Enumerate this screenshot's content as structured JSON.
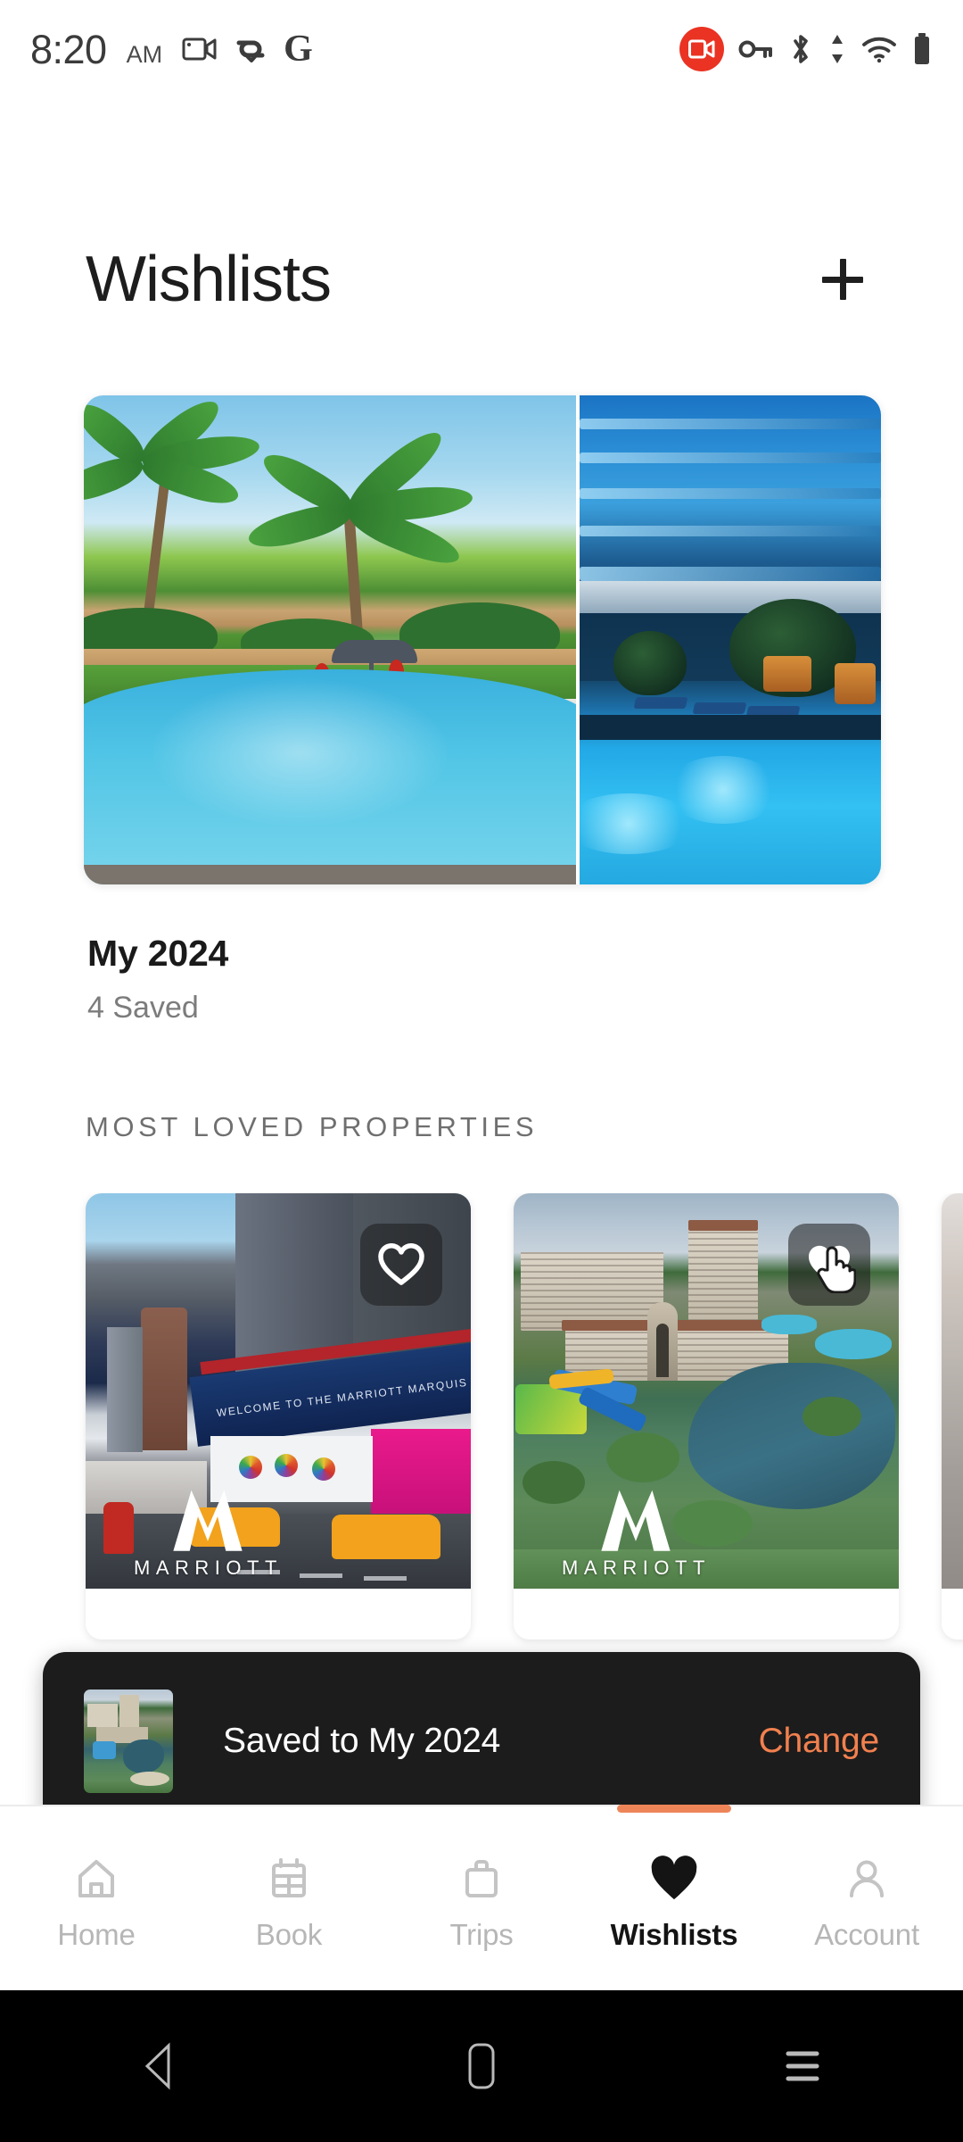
{
  "status_bar": {
    "time": "8:20",
    "meridiem": "AM",
    "left_icons": [
      "video-camera-icon",
      "link-connection-icon",
      "google-g-icon"
    ],
    "right_icons": [
      "screen-recording-badge-icon",
      "vpn-key-icon",
      "bluetooth-icon",
      "data-transfer-icon",
      "wifi-icon",
      "battery-icon"
    ],
    "recording_badge_color": "#EA3323"
  },
  "header": {
    "title": "Wishlists",
    "add_icon": "plus-icon"
  },
  "wishlist": {
    "name": "My 2024",
    "saved_count": "4 Saved",
    "images": [
      {
        "alt": "tropical-resort-pool-with-palm-trees"
      },
      {
        "alt": "night-lit-hotel-pool"
      }
    ]
  },
  "section": {
    "heading": "MOST LOVED PROPERTIES"
  },
  "properties": [
    {
      "image_alt": "marriott-marquis-times-square",
      "brand": "MARRIOTT",
      "favorite_icon": "heart-outline-icon",
      "favorited": false
    },
    {
      "image_alt": "orlando-world-center-marriott-resort",
      "brand": "MARRIOTT",
      "favorite_icon": "heart-filled-icon",
      "favorited": true,
      "cursor_overlay": "pointer-hand-cursor"
    },
    {
      "image_alt": "partial-property-card-peek",
      "brand": "",
      "favorite_icon": "",
      "favorited": false
    }
  ],
  "toast": {
    "thumbnail_alt": "orlando-world-center-marriott-resort",
    "message": "Saved to My 2024",
    "action_label": "Change",
    "action_color": "#F2804F",
    "background": "#1c1c1c"
  },
  "bottom_nav": {
    "active_index": 3,
    "indicator_color": "#EE8559",
    "items": [
      {
        "label": "Home",
        "icon": "home-icon"
      },
      {
        "label": "Book",
        "icon": "calendar-icon"
      },
      {
        "label": "Trips",
        "icon": "suitcase-icon"
      },
      {
        "label": "Wishlists",
        "icon": "heart-filled-icon"
      },
      {
        "label": "Account",
        "icon": "person-icon"
      }
    ]
  },
  "system_nav": {
    "items": [
      {
        "icon": "back-triangle-icon"
      },
      {
        "icon": "home-square-icon"
      },
      {
        "icon": "recents-menu-icon"
      }
    ]
  }
}
